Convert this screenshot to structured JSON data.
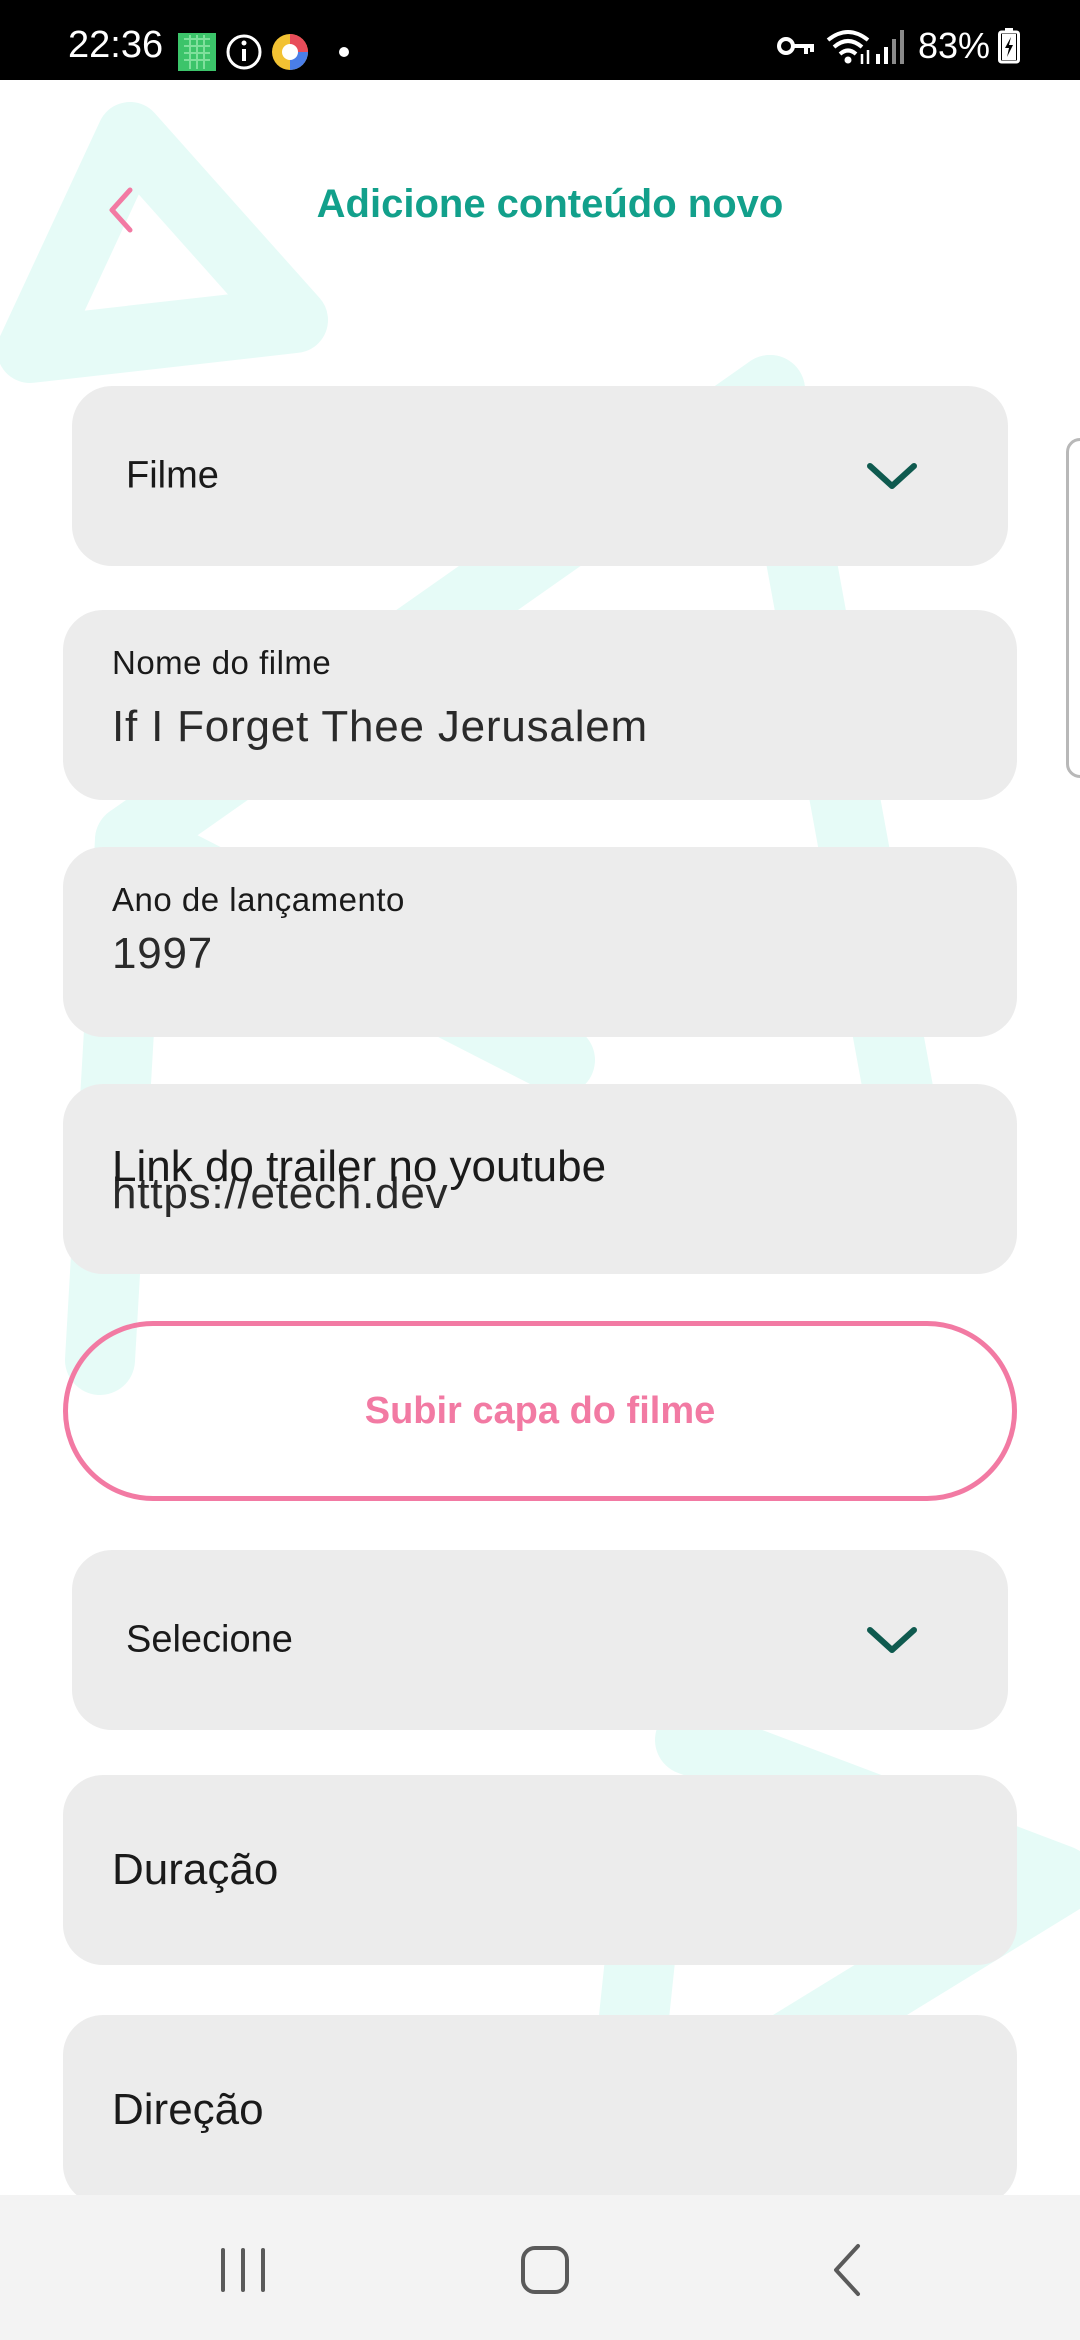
{
  "status_bar": {
    "time": "22:36",
    "battery": "83%",
    "icons": [
      "gallery-icon",
      "info-icon",
      "colorful-app-icon",
      "notification-dot-icon",
      "vpn-key-icon",
      "wifi-icon",
      "signal-icon",
      "battery-charging-icon"
    ]
  },
  "header": {
    "title": "Adicione conteúdo novo",
    "back_icon": "chevron-left-icon"
  },
  "form": {
    "type_select": {
      "value": "Filme",
      "icon": "chevron-down-icon"
    },
    "movie_name": {
      "label": "Nome do filme",
      "value": "If I Forget Thee Jerusalem"
    },
    "release_year": {
      "label": "Ano de lançamento",
      "value": "1997"
    },
    "trailer": {
      "placeholder": "Link do trailer no youtube",
      "value": "https://etech.dev"
    },
    "upload_button": {
      "label": "Subir capa do filme"
    },
    "category_select": {
      "value": "Selecione",
      "icon": "chevron-down-icon"
    },
    "duration": {
      "placeholder": "Duração"
    },
    "direction": {
      "placeholder": "Direção"
    }
  },
  "nav_bar": {
    "icons": [
      "recent-apps-icon",
      "home-icon",
      "back-icon"
    ]
  },
  "colors": {
    "accent_teal": "#12a08b",
    "accent_pink": "#f27aa3",
    "field_bg": "#ececec",
    "deco_mint": "#e6fbf7"
  }
}
